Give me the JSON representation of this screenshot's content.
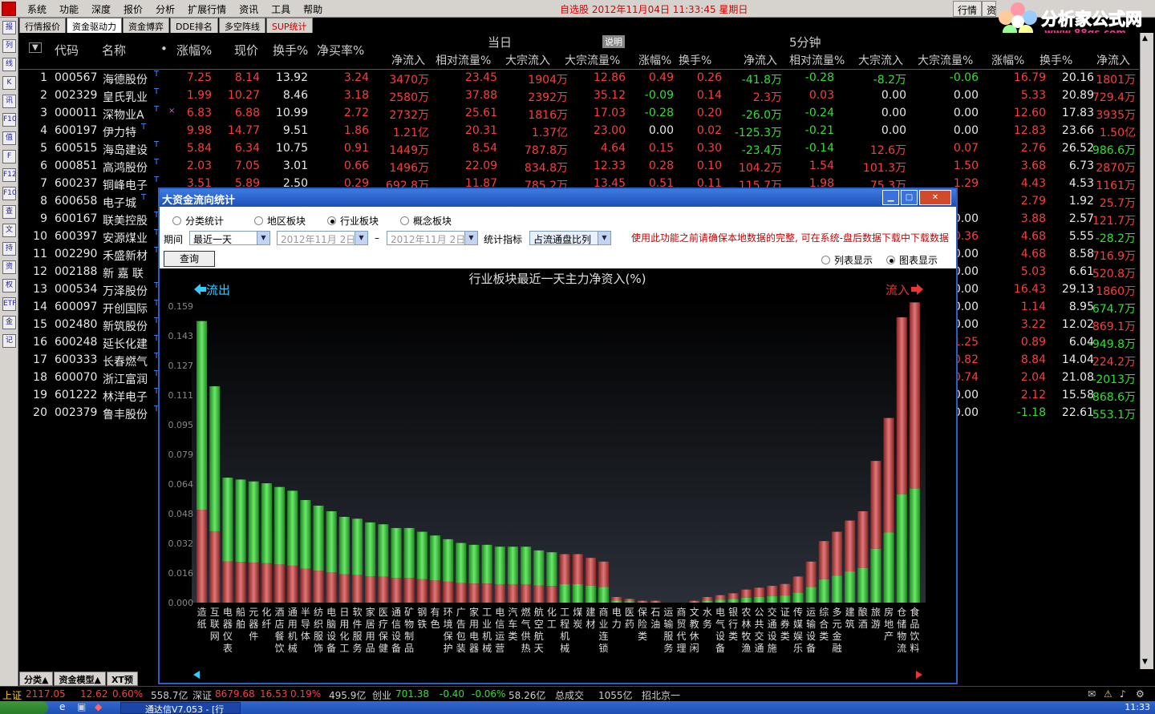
{
  "menubar": {
    "items": [
      "系统",
      "功能",
      "深度",
      "报价",
      "分析",
      "扩展行情",
      "资讯",
      "工具",
      "帮助"
    ],
    "title": "自选股  2012年11月04日  11:33:45  星期日",
    "right": [
      "行情",
      "资"
    ]
  },
  "tabs": [
    "行情报价",
    "资金驱动力",
    "资金博弈",
    "DDE排名",
    "多空阵线",
    "SUP统计"
  ],
  "left_toolbar": [
    "报",
    "列",
    "线",
    "K",
    "讯",
    "F10",
    "值",
    "F",
    "F12",
    "F10",
    "查",
    "文",
    "持",
    "资",
    "权",
    "ETF",
    "金",
    "记"
  ],
  "watermark": {
    "title": "分析家公式网",
    "url": "www.88gs.com"
  },
  "header": {
    "sort": "▼",
    "code": "代码",
    "name": "名称",
    "dot": "•",
    "zf": "涨幅%",
    "price": "现价",
    "hs": "换手%",
    "jmr": "净买率%",
    "today": "当日",
    "explain": "说明",
    "five": "5分钟",
    "sub": [
      "净流入",
      "相对流量%",
      "大宗流入",
      "大宗流量%",
      "涨幅%",
      "换手%",
      "净流入",
      "相对流量%",
      "大宗流入",
      "大宗流量%",
      "涨幅%",
      "换手%",
      "净流入"
    ]
  },
  "rows": [
    {
      "no": "1",
      "code": "000567",
      "name": "海德股份",
      "m": "T",
      "zf": "7.25",
      "price": "8.14",
      "hs": "13.92",
      "jmr": "3.24",
      "d": [
        "3470万",
        "23.45",
        "1904万",
        "12.86"
      ],
      "f": [
        "0.49",
        "0.26",
        "-41.8万",
        "-0.28",
        "-8.2万",
        "-0.06"
      ],
      "r": [
        "16.79",
        "20.16",
        "1801万"
      ]
    },
    {
      "no": "2",
      "code": "002329",
      "name": "皇氏乳业",
      "m": "T",
      "zf": "1.99",
      "price": "10.27",
      "hs": "8.46",
      "jmr": "3.18",
      "d": [
        "2580万",
        "37.88",
        "2392万",
        "35.12"
      ],
      "f": [
        "-0.09",
        "0.14",
        "2.3万",
        "0.03",
        "0.00",
        "0.00"
      ],
      "r": [
        "5.33",
        "20.89",
        "729.4万"
      ]
    },
    {
      "no": "3",
      "code": "000011",
      "name": "深物业A",
      "m": "T",
      "x": "×",
      "zf": "6.83",
      "price": "6.88",
      "hs": "10.99",
      "jmr": "2.72",
      "d": [
        "2732万",
        "25.61",
        "1816万",
        "17.03"
      ],
      "f": [
        "-0.28",
        "0.20",
        "-26.0万",
        "-0.24",
        "0.00",
        "0.00"
      ],
      "r": [
        "12.60",
        "17.83",
        "3935万"
      ]
    },
    {
      "no": "4",
      "code": "600197",
      "name": "伊力特",
      "m": "T",
      "zf": "9.98",
      "price": "14.77",
      "hs": "9.51",
      "jmr": "1.86",
      "d": [
        "1.21亿",
        "20.31",
        "1.37亿",
        "23.00"
      ],
      "f": [
        "0.00",
        "0.02",
        "-125.3万",
        "-0.21",
        "0.00",
        "0.00"
      ],
      "r": [
        "12.83",
        "23.66",
        "1.50亿"
      ]
    },
    {
      "no": "5",
      "code": "600515",
      "name": "海岛建设",
      "m": "T",
      "zf": "5.84",
      "price": "6.34",
      "hs": "10.75",
      "jmr": "0.91",
      "d": [
        "1449万",
        "8.54",
        "787.8万",
        "4.64"
      ],
      "f": [
        "0.15",
        "0.30",
        "-23.4万",
        "-0.14",
        "12.6万",
        "0.07"
      ],
      "r": [
        "2.76",
        "26.52",
        "-986.6万"
      ]
    },
    {
      "no": "6",
      "code": "000851",
      "name": "高鸿股份",
      "m": "T",
      "zf": "2.03",
      "price": "7.05",
      "hs": "3.01",
      "jmr": "0.66",
      "d": [
        "1496万",
        "22.09",
        "834.8万",
        "12.33"
      ],
      "f": [
        "0.28",
        "0.10",
        "104.2万",
        "1.54",
        "101.3万",
        "1.50"
      ],
      "r": [
        "3.68",
        "6.73",
        "2870万"
      ]
    },
    {
      "no": "7",
      "code": "600237",
      "name": "铜峰电子",
      "m": "T",
      "zf": "3.51",
      "price": "5.89",
      "hs": "2.50",
      "jmr": "0.29",
      "d": [
        "692.8万",
        "11.87",
        "785.2万",
        "13.45"
      ],
      "f": [
        "0.51",
        "0.11",
        "115.7万",
        "1.98",
        "75.3万",
        "1.29"
      ],
      "r": [
        "4.43",
        "4.53",
        "1161万"
      ]
    },
    {
      "no": "8",
      "code": "600658",
      "name": "电子城",
      "m": "T",
      "r": [
        "2.79",
        "1.92",
        "25.7万"
      ]
    },
    {
      "no": "9",
      "code": "600167",
      "name": "联美控股",
      "m": "T",
      "r5": "0.00",
      "r": [
        "3.88",
        "2.57",
        "121.7万"
      ]
    },
    {
      "no": "10",
      "code": "600397",
      "name": "安源煤业",
      "m": "T",
      "r5": "0.36",
      "r": [
        "4.68",
        "5.55",
        "-28.2万"
      ]
    },
    {
      "no": "11",
      "code": "002290",
      "name": "禾盛新材",
      "m": "T",
      "r5": "0.00",
      "r": [
        "4.68",
        "8.58",
        "716.9万"
      ]
    },
    {
      "no": "12",
      "code": "002188",
      "name": "新 嘉 联",
      "m": "T",
      "r5": "0.00",
      "r": [
        "5.03",
        "6.61",
        "520.8万"
      ]
    },
    {
      "no": "13",
      "code": "000534",
      "name": "万泽股份",
      "m": "T",
      "r5": "0.00",
      "r": [
        "16.43",
        "29.13",
        "1860万"
      ]
    },
    {
      "no": "14",
      "code": "600097",
      "name": "开创国际",
      "m": "T",
      "r5": "0.00",
      "r": [
        "1.14",
        "8.95",
        "-674.7万"
      ]
    },
    {
      "no": "15",
      "code": "002480",
      "name": "新筑股份",
      "m": "T",
      "r5": "0.00",
      "r": [
        "3.22",
        "12.02",
        "869.1万"
      ]
    },
    {
      "no": "16",
      "code": "600248",
      "name": "延长化建",
      "m": "T",
      "r5": "1.25",
      "r": [
        "0.89",
        "6.04",
        "-949.8万"
      ]
    },
    {
      "no": "17",
      "code": "600333",
      "name": "长春燃气",
      "m": "T",
      "r5": "0.82",
      "r": [
        "8.84",
        "14.04",
        "224.2万"
      ]
    },
    {
      "no": "18",
      "code": "600070",
      "name": "浙江富润",
      "m": "T",
      "r5": "0.74",
      "r": [
        "2.04",
        "21.08",
        "-2013万"
      ]
    },
    {
      "no": "19",
      "code": "601222",
      "name": "林洋电子",
      "m": "T",
      "r5": "0.00",
      "r": [
        "2.12",
        "15.58",
        "-868.6万"
      ]
    },
    {
      "no": "20",
      "code": "002379",
      "name": "鲁丰股份",
      "m": "T",
      "r5": "0.00",
      "r": [
        "-1.18",
        "22.61",
        "-553.1万"
      ]
    }
  ],
  "dialog": {
    "title": "大资金流向统计",
    "radios": [
      "分类统计",
      "地区板块",
      "行业板块",
      "概念板块"
    ],
    "period_label": "期间",
    "period": "最近一天",
    "date1": "2012年11月 2日",
    "dash": "–",
    "date2": "2012年11月 2日",
    "metric_label": "统计指标",
    "metric": "占流通盘比列",
    "warn": "使用此功能之前请确保本地数据的完整, 可在系统-盘后数据下载中下载数据",
    "query": "查询",
    "view_list": "列表显示",
    "view_chart": "图表显示"
  },
  "chart_data": {
    "type": "bar",
    "title": "行业板块最近一天主力净资入(%)",
    "left_label": "流出",
    "right_label": "流入",
    "yticks": [
      "0.000",
      "0.016",
      "0.032",
      "0.048",
      "0.064",
      "0.079",
      "0.095",
      "0.111",
      "0.127",
      "0.143",
      "0.159"
    ],
    "ylim": [
      0,
      0.159
    ],
    "categories": [
      "造纸",
      "互联网",
      "电器仪表",
      "船舶",
      "元器件",
      "化纤",
      "酒店餐饮",
      "通用机械",
      "半导体",
      "纺织服饰",
      "电脑设备",
      "日用化工",
      "软件服务",
      "家居用品",
      "医疗保健",
      "通信设备",
      "矿物制品",
      "钢铁",
      "有色",
      "环境保护",
      "广告包装",
      "家用电器",
      "工业机械",
      "电信运营",
      "汽车类",
      "燃气供热",
      "航空航天",
      "化工",
      "工程机械",
      "煤炭",
      "建材",
      "商业连锁",
      "电力",
      "医药",
      "保险类",
      "石油",
      "运输服务",
      "商贸代理",
      "文教休闲",
      "水务",
      "电气设备",
      "银行类",
      "农林牧渔",
      "公共交通",
      "交通设施",
      "证券类",
      "传媒娱乐",
      "运输设备",
      "综合类",
      "多元金融",
      "建筑",
      "酿酒",
      "旅游",
      "房地产",
      "仓储物流",
      "食品饮料"
    ],
    "series": [
      {
        "values": [
          0.151,
          0.116,
          0.067,
          0.066,
          0.065,
          0.064,
          0.062,
          0.06,
          0.055,
          0.052,
          0.049,
          0.046,
          0.045,
          0.043,
          0.042,
          0.04,
          0.04,
          0.038,
          0.036,
          0.034,
          0.032,
          0.031,
          0.031,
          0.03,
          0.03,
          0.03,
          0.028,
          0.027,
          0.026,
          0.026,
          0.024,
          0.022,
          0.003,
          0.002,
          0.001,
          0.001,
          0.0,
          0.0,
          0.001,
          0.003,
          0.004,
          0.005,
          0.007,
          0.008,
          0.009,
          0.01,
          0.014,
          0.022,
          0.033,
          0.038,
          0.044,
          0.049,
          0.076,
          0.099,
          0.153,
          0.161
        ]
      }
    ]
  },
  "bottom_tabs": [
    "分类▲",
    "资金模型▲",
    "XT预"
  ],
  "status": {
    "sh": "上证",
    "sh_v": "2117.05",
    "sh_c": "12.62",
    "sh_p": "0.60%",
    "sh_a": "558.7亿",
    "sz": "深证",
    "sz_v": "8679.68",
    "sz_c": "16.53",
    "sz_p": "0.19%",
    "sz_a": "495.9亿",
    "cy": "创业",
    "cy_v": "701.38",
    "cy_c": "-0.40",
    "cy_p": "-0.06%",
    "cy_a": "58.26亿",
    "tot": "总成交",
    "tot_v": "1055亿",
    "bj": "招北京一"
  },
  "taskbar": {
    "item": "通达信V7.053 - [行",
    "clock": "11:33"
  }
}
